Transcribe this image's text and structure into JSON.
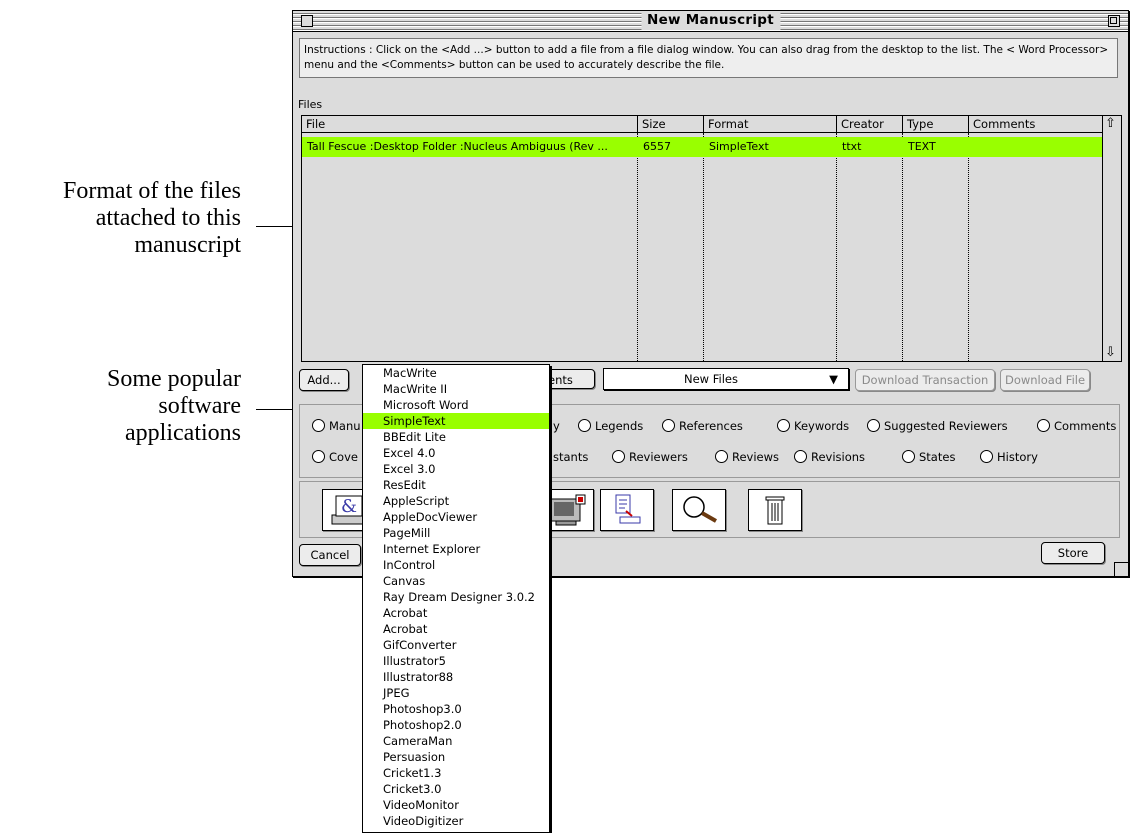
{
  "annotations": [
    {
      "lines": [
        "Format of the files",
        "attached to this",
        "manuscript"
      ]
    },
    {
      "lines": [
        "Some popular",
        "software",
        "applications"
      ]
    }
  ],
  "window": {
    "title": "New Manuscript",
    "instructions": "Instructions : Click on the <Add ...> button to add a file from a file dialog window.  You can also drag from the desktop to the list.  The < Word Processor> menu and the <Comments> button can be used to accurately describe the file.",
    "files_label": "Files",
    "columns": [
      "File",
      "Size",
      "Format",
      "Creator",
      "Type",
      "Comments"
    ],
    "rows": [
      {
        "file": "Tall Fescue :Desktop Folder :Nucleus Ambiguus (Rev ...",
        "size": "6557",
        "format": "SimpleText",
        "creator": "ttxt",
        "type": "TEXT",
        "comments": ""
      }
    ],
    "buttons": {
      "add": "Add...",
      "comments_partial": "ents",
      "popup_value": "New Files",
      "download_transaction": "Download Transaction",
      "download_file": "Download File",
      "cancel": "Cancel",
      "store": "Store"
    },
    "radios_row1": [
      {
        "label": "Manu"
      },
      {
        "label": "y"
      },
      {
        "label": "Legends"
      },
      {
        "label": "References"
      },
      {
        "label": "Keywords"
      },
      {
        "label": "Suggested Reviewers"
      },
      {
        "label": "Comments"
      }
    ],
    "radios_row2": [
      {
        "label": "Cove"
      },
      {
        "label": "stants"
      },
      {
        "label": "Reviewers"
      },
      {
        "label": "Reviews"
      },
      {
        "label": "Revisions"
      },
      {
        "label": "States"
      },
      {
        "label": "History"
      }
    ],
    "tools": [
      {
        "icon": "word-processor-icon"
      },
      {
        "icon": "computer-icon"
      },
      {
        "icon": "document-download-icon"
      },
      {
        "icon": "magnifier-icon"
      },
      {
        "icon": "trash-icon"
      }
    ],
    "highlight_color": "#99ff00"
  },
  "menu": {
    "selected": "SimpleText",
    "items": [
      "MacWrite",
      "MacWrite II",
      "Microsoft Word",
      "SimpleText",
      "BBEdit Lite",
      "Excel 4.0",
      "Excel 3.0",
      "ResEdit",
      "AppleScript",
      "AppleDocViewer",
      "PageMill",
      "Internet Explorer",
      "InControl",
      "Canvas",
      "Ray Dream Designer 3.0.2",
      "Acrobat",
      "Acrobat",
      "GifConverter",
      "Illustrator5",
      "Illustrator88",
      "JPEG",
      "Photoshop3.0",
      "Photoshop2.0",
      "CameraMan",
      "Persuasion",
      "Cricket1.3",
      "Cricket3.0",
      "VideoMonitor",
      "VideoDigitizer"
    ]
  }
}
